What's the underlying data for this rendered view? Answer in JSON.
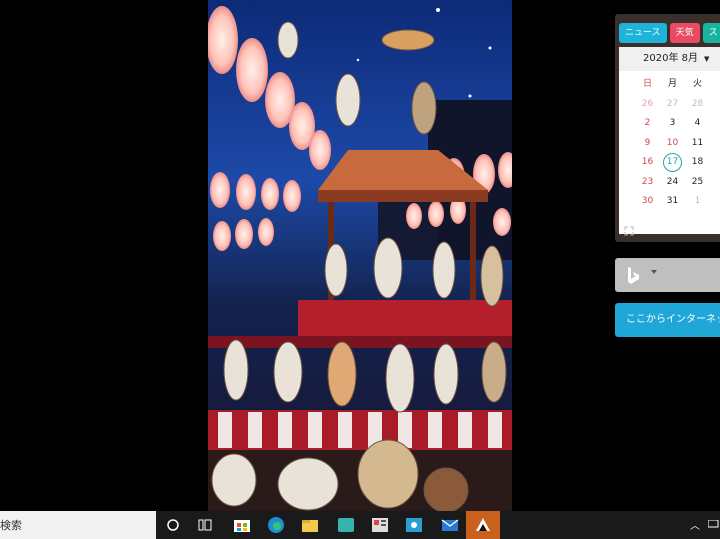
{
  "calendar": {
    "tabs": [
      {
        "label": "ニュース",
        "color": "#1eb3d8"
      },
      {
        "label": "天気",
        "color": "#e94b63"
      },
      {
        "label": "ス",
        "color": "#1ab3a0"
      }
    ],
    "month_label": "2020年  8月",
    "weekdays": [
      "日",
      "月",
      "火"
    ],
    "weeks": [
      [
        "26",
        "27",
        "28"
      ],
      [
        "2",
        "3",
        "4"
      ],
      [
        "9",
        "10",
        "11"
      ],
      [
        "16",
        "17",
        "18"
      ],
      [
        "23",
        "24",
        "25"
      ],
      [
        "30",
        "31",
        "1"
      ]
    ],
    "today": "17"
  },
  "internet_button": {
    "label": "ここからインターネット"
  },
  "taskbar": {
    "search_placeholder": "検索",
    "icons": [
      "cortana-icon",
      "task-view-icon",
      "store-icon",
      "edge-icon",
      "file-explorer-icon",
      "app-icon",
      "news-icon",
      "photos-icon",
      "mail-icon",
      "active-app-icon"
    ]
  },
  "colors": {
    "accent": "#1fa7d8",
    "today": "#2aa5a0",
    "sunday": "#d9454a"
  }
}
